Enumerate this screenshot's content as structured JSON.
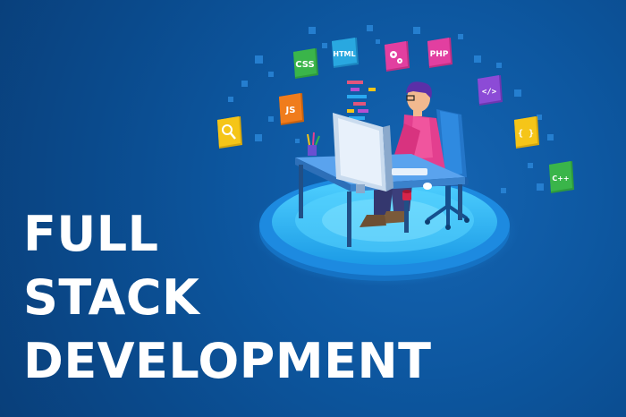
{
  "headline": {
    "line1": "FULL",
    "line2": "STACK",
    "line3": "DEVELOPMENT"
  },
  "tech_cards": [
    {
      "label": "CSS",
      "color": "#3ab54a",
      "icon": "css-icon"
    },
    {
      "label": "HTML",
      "color": "#29a8e0",
      "icon": "html-icon"
    },
    {
      "label": "",
      "color": "#e23fa0",
      "icon": "gears-icon"
    },
    {
      "label": "PHP",
      "color": "#e23fa0",
      "icon": "php-icon"
    },
    {
      "label": "</>",
      "color": "#8c4bd6",
      "icon": "code-tag-icon"
    },
    {
      "label": "JS",
      "color": "#f07c1c",
      "icon": "javascript-icon"
    },
    {
      "label": "",
      "color": "#f5c518",
      "icon": "search-icon"
    },
    {
      "label": "{ }",
      "color": "#f5c518",
      "icon": "curly-braces-icon"
    },
    {
      "label": "C++",
      "color": "#3ab54a",
      "icon": "cplusplus-icon"
    }
  ],
  "colors": {
    "background": "#0a4a8c",
    "platform": "#29b6f6",
    "shirt": "#e33f8f",
    "hair": "#5b2fa8"
  }
}
